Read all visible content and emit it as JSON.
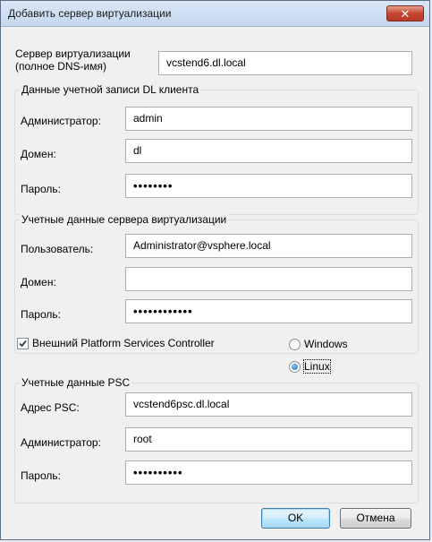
{
  "window": {
    "title": "Добавить сервер виртуализации",
    "close_glyph": "✕"
  },
  "server": {
    "label_line1": "Сервер виртуализации",
    "label_line2": "(полное DNS-имя)",
    "value": "vcstend6.dl.local"
  },
  "dl_group": {
    "legend": "Данные учетной записи DL клиента",
    "admin_label": "Администратор:",
    "admin_value": "admin",
    "domain_label": "Домен:",
    "domain_value": "dl",
    "password_label": "Пароль:",
    "password_value": "••••••••"
  },
  "virt_group": {
    "legend": "Учетные данные сервера виртуализации",
    "user_label": "Пользователь:",
    "user_value": "Administrator@vsphere.local",
    "domain_label": "Домен:",
    "domain_value": "",
    "password_label": "Пароль:",
    "password_value": "••••••••••••"
  },
  "psc_option": {
    "checkbox_label": "Внешний Platform Services Controller",
    "checked": true,
    "radio_windows": "Windows",
    "radio_linux": "Linux",
    "selected": "Linux"
  },
  "psc_group": {
    "legend": "Учетные данные PSC",
    "address_label": "Адрес PSC:",
    "address_value": "vcstend6psc.dl.local",
    "admin_label": "Администратор:",
    "admin_value": "root",
    "password_label": "Пароль:",
    "password_value": "••••••••••"
  },
  "buttons": {
    "ok": "OK",
    "cancel": "Отмена"
  }
}
